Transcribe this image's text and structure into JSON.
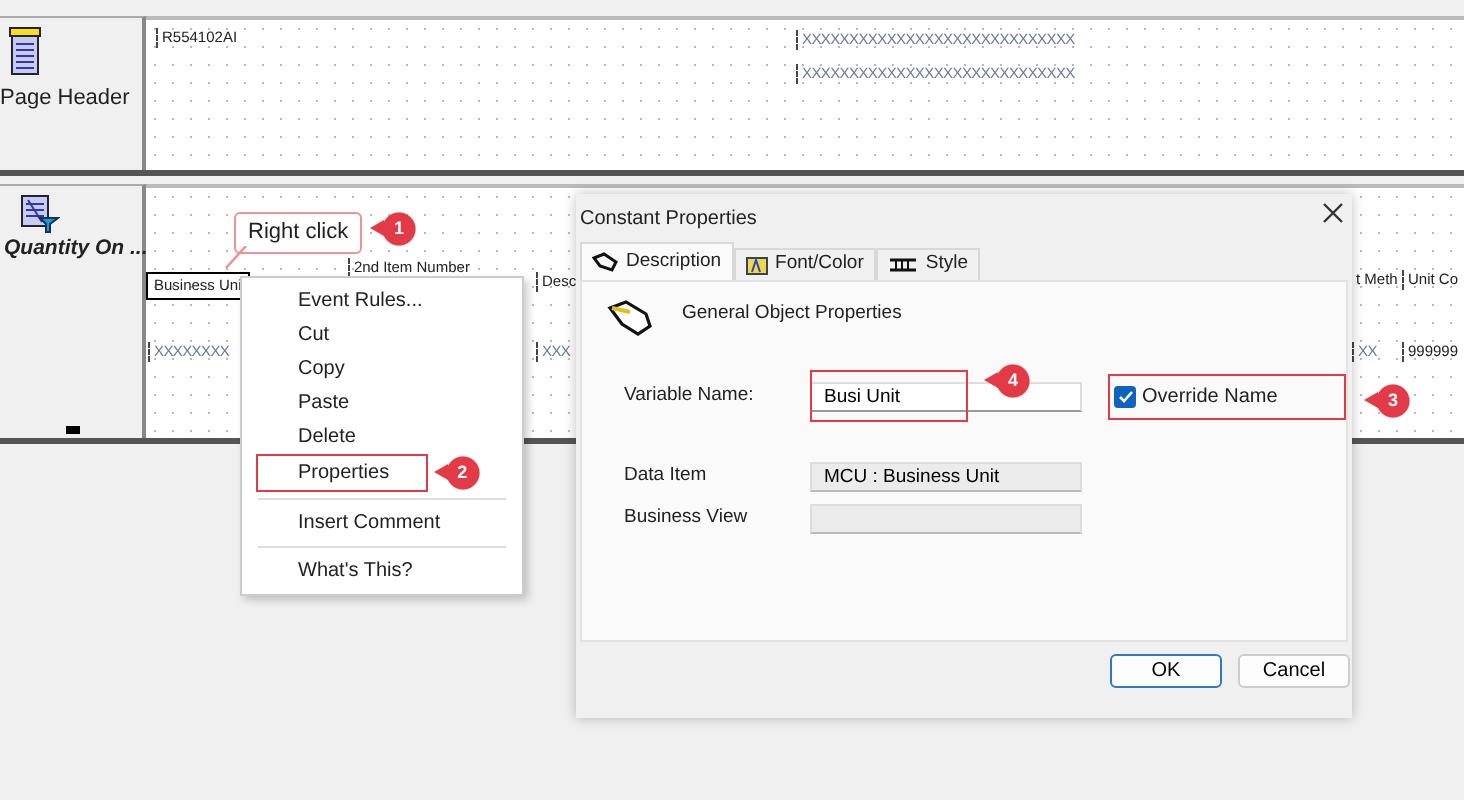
{
  "sections": [
    {
      "label": "Page Header",
      "kind": "header",
      "items": [
        {
          "text": "R554102AI",
          "selected": false
        },
        {
          "text": "XXXXXXXXXXXXXXXXXXXXXXXXXXXXX",
          "selected": false
        },
        {
          "text": "XXXXXXXXXXXXXXXXXXXXXXXXXXXXX",
          "selected": false
        }
      ]
    },
    {
      "label": "Quantity On ...",
      "kind": "detail",
      "items": [
        {
          "text": "Business Uni",
          "selected": true
        },
        {
          "text": "2nd Item Number",
          "selected": false
        },
        {
          "text": "Desc",
          "selected": false
        },
        {
          "text": "t Meth",
          "selected": false
        },
        {
          "text": "Unit Co",
          "selected": false
        },
        {
          "text": "XXXXXXXX",
          "selected": false
        },
        {
          "text": "XXX",
          "selected": false
        },
        {
          "text": "XX",
          "selected": false
        },
        {
          "text": "999999",
          "selected": false
        }
      ]
    }
  ],
  "callout": {
    "text": "Right click",
    "number": "1"
  },
  "context_menu": [
    {
      "kind": "item",
      "label": "Event Rules..."
    },
    {
      "kind": "item",
      "label": "Cut"
    },
    {
      "kind": "item",
      "label": "Copy"
    },
    {
      "kind": "item",
      "label": "Paste"
    },
    {
      "kind": "item",
      "label": "Delete"
    },
    {
      "kind": "item",
      "label": "Properties",
      "annotation": "2"
    },
    {
      "kind": "separator"
    },
    {
      "kind": "item",
      "label": "Insert Comment"
    },
    {
      "kind": "separator"
    },
    {
      "kind": "item",
      "label": "What's This?"
    }
  ],
  "dialog": {
    "title": "Constant Properties",
    "tabs": [
      {
        "label": "Description",
        "selected": true
      },
      {
        "label": "Font/Color",
        "selected": false
      },
      {
        "label": "Style",
        "selected": false
      }
    ],
    "group_title": "General Object Properties",
    "fields": [
      {
        "label": "Variable Name:",
        "value": "Busi Unit",
        "editable": true,
        "annotation": "4"
      },
      {
        "label": "Data Item",
        "value": "MCU : Business Unit",
        "editable": false
      },
      {
        "label": "Business View",
        "editable": false
      }
    ],
    "override": {
      "label": "Override Name",
      "checked": true,
      "annotation": "3"
    },
    "buttons": [
      {
        "label": "OK",
        "default": true
      },
      {
        "label": "Cancel",
        "default": false
      }
    ]
  }
}
